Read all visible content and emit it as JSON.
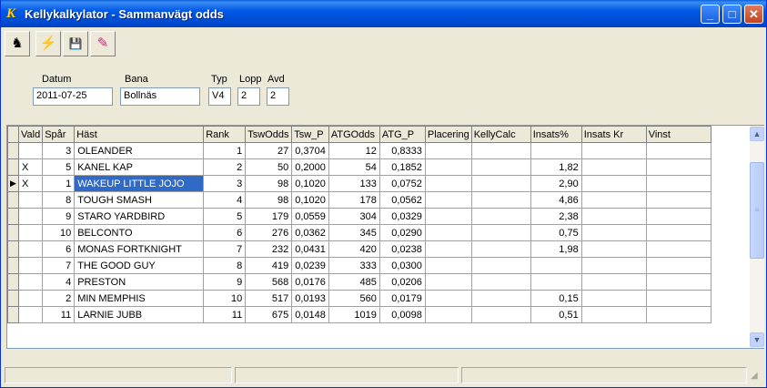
{
  "window": {
    "title": "Kellykalkylator - Sammanvägt odds",
    "icon": "kelly-app-icon",
    "caption_buttons": [
      "minimize",
      "maximize",
      "close"
    ]
  },
  "toolbar": {
    "buttons": [
      {
        "name": "horse-icon",
        "glyph": "♞"
      },
      {
        "name": "lightning-icon",
        "glyph": "⚡"
      },
      {
        "name": "save-icon",
        "glyph": "💾"
      },
      {
        "name": "eraser-icon",
        "glyph": "✎"
      }
    ]
  },
  "form": {
    "datum_label": "Datum",
    "datum_value": "2011-07-25",
    "bana_label": "Bana",
    "bana_value": "Bollnäs",
    "typ_label": "Typ",
    "typ_value": "V4",
    "lopp_label": "Lopp",
    "lopp_value": "2",
    "avd_label": "Avd",
    "avd_value": "2"
  },
  "grid": {
    "columns": [
      "Vald",
      "Spår",
      "Häst",
      "Rank",
      "TswOdds",
      "Tsw_P",
      "ATGOdds",
      "ATG_P",
      "Placering",
      "KellyCalc",
      "Insats%",
      "Insats Kr",
      "Vinst"
    ],
    "selected_row": 2,
    "rows": [
      {
        "vald": "",
        "spar": "3",
        "hast": "OLEANDER",
        "rank": "1",
        "tswodds": "27",
        "tsw_p": "0,3704",
        "atgodds": "12",
        "atg_p": "0,8333",
        "placering": "",
        "kellycalc": "",
        "insats_pct": "",
        "insats_kr": "",
        "vinst": ""
      },
      {
        "vald": "X",
        "spar": "5",
        "hast": "KANEL KAP",
        "rank": "2",
        "tswodds": "50",
        "tsw_p": "0,2000",
        "atgodds": "54",
        "atg_p": "0,1852",
        "placering": "",
        "kellycalc": "",
        "insats_pct": "1,82",
        "insats_kr": "",
        "vinst": ""
      },
      {
        "vald": "X",
        "spar": "1",
        "hast": "WAKEUP LITTLE JOJO",
        "rank": "3",
        "tswodds": "98",
        "tsw_p": "0,1020",
        "atgodds": "133",
        "atg_p": "0,0752",
        "placering": "",
        "kellycalc": "",
        "insats_pct": "2,90",
        "insats_kr": "",
        "vinst": ""
      },
      {
        "vald": "",
        "spar": "8",
        "hast": "TOUGH SMASH",
        "rank": "4",
        "tswodds": "98",
        "tsw_p": "0,1020",
        "atgodds": "178",
        "atg_p": "0,0562",
        "placering": "",
        "kellycalc": "",
        "insats_pct": "4,86",
        "insats_kr": "",
        "vinst": ""
      },
      {
        "vald": "",
        "spar": "9",
        "hast": "STARO YARDBIRD",
        "rank": "5",
        "tswodds": "179",
        "tsw_p": "0,0559",
        "atgodds": "304",
        "atg_p": "0,0329",
        "placering": "",
        "kellycalc": "",
        "insats_pct": "2,38",
        "insats_kr": "",
        "vinst": ""
      },
      {
        "vald": "",
        "spar": "10",
        "hast": "BELCONTO",
        "rank": "6",
        "tswodds": "276",
        "tsw_p": "0,0362",
        "atgodds": "345",
        "atg_p": "0,0290",
        "placering": "",
        "kellycalc": "",
        "insats_pct": "0,75",
        "insats_kr": "",
        "vinst": ""
      },
      {
        "vald": "",
        "spar": "6",
        "hast": "MONAS FORTKNIGHT",
        "rank": "7",
        "tswodds": "232",
        "tsw_p": "0,0431",
        "atgodds": "420",
        "atg_p": "0,0238",
        "placering": "",
        "kellycalc": "",
        "insats_pct": "1,98",
        "insats_kr": "",
        "vinst": ""
      },
      {
        "vald": "",
        "spar": "7",
        "hast": "THE GOOD GUY",
        "rank": "8",
        "tswodds": "419",
        "tsw_p": "0,0239",
        "atgodds": "333",
        "atg_p": "0,0300",
        "placering": "",
        "kellycalc": "",
        "insats_pct": "",
        "insats_kr": "",
        "vinst": ""
      },
      {
        "vald": "",
        "spar": "4",
        "hast": "PRESTON",
        "rank": "9",
        "tswodds": "568",
        "tsw_p": "0,0176",
        "atgodds": "485",
        "atg_p": "0,0206",
        "placering": "",
        "kellycalc": "",
        "insats_pct": "",
        "insats_kr": "",
        "vinst": ""
      },
      {
        "vald": "",
        "spar": "2",
        "hast": "MIN MEMPHIS",
        "rank": "10",
        "tswodds": "517",
        "tsw_p": "0,0193",
        "atgodds": "560",
        "atg_p": "0,0179",
        "placering": "",
        "kellycalc": "",
        "insats_pct": "0,15",
        "insats_kr": "",
        "vinst": ""
      },
      {
        "vald": "",
        "spar": "11",
        "hast": "LARNIE JUBB",
        "rank": "11",
        "tswodds": "675",
        "tsw_p": "0,0148",
        "atgodds": "1019",
        "atg_p": "0,0098",
        "placering": "",
        "kellycalc": "",
        "insats_pct": "0,51",
        "insats_kr": "",
        "vinst": ""
      }
    ]
  },
  "statusbar": {
    "panes": [
      "",
      "",
      ""
    ]
  }
}
